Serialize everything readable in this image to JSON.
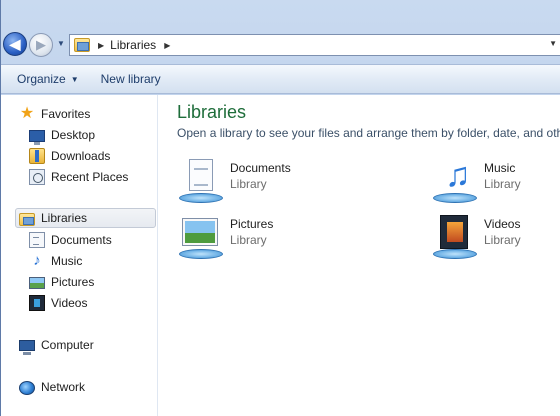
{
  "address": {
    "crumb": "Libraries"
  },
  "toolbar": {
    "organize_label": "Organize",
    "new_library_label": "New library"
  },
  "nav": {
    "favorites": {
      "label": "Favorites",
      "items": [
        {
          "label": "Desktop"
        },
        {
          "label": "Downloads"
        },
        {
          "label": "Recent Places"
        }
      ]
    },
    "libraries": {
      "label": "Libraries",
      "items": [
        {
          "label": "Documents"
        },
        {
          "label": "Music"
        },
        {
          "label": "Pictures"
        },
        {
          "label": "Videos"
        }
      ]
    },
    "computer_label": "Computer",
    "network_label": "Network"
  },
  "main": {
    "title": "Libraries",
    "subtitle": "Open a library to see your files and arrange them by folder, date, and other properties.",
    "libraries": [
      {
        "name": "Documents",
        "type": "Library",
        "icon": "documents-library-icon"
      },
      {
        "name": "Music",
        "type": "Library",
        "icon": "music-library-icon"
      },
      {
        "name": "Pictures",
        "type": "Library",
        "icon": "pictures-library-icon"
      },
      {
        "name": "Videos",
        "type": "Library",
        "icon": "videos-library-icon"
      }
    ]
  },
  "colors": {
    "title_green": "#1e6d3a",
    "toolbar_text": "#1e3d6b",
    "frame_blue": "#b7cbe8"
  }
}
